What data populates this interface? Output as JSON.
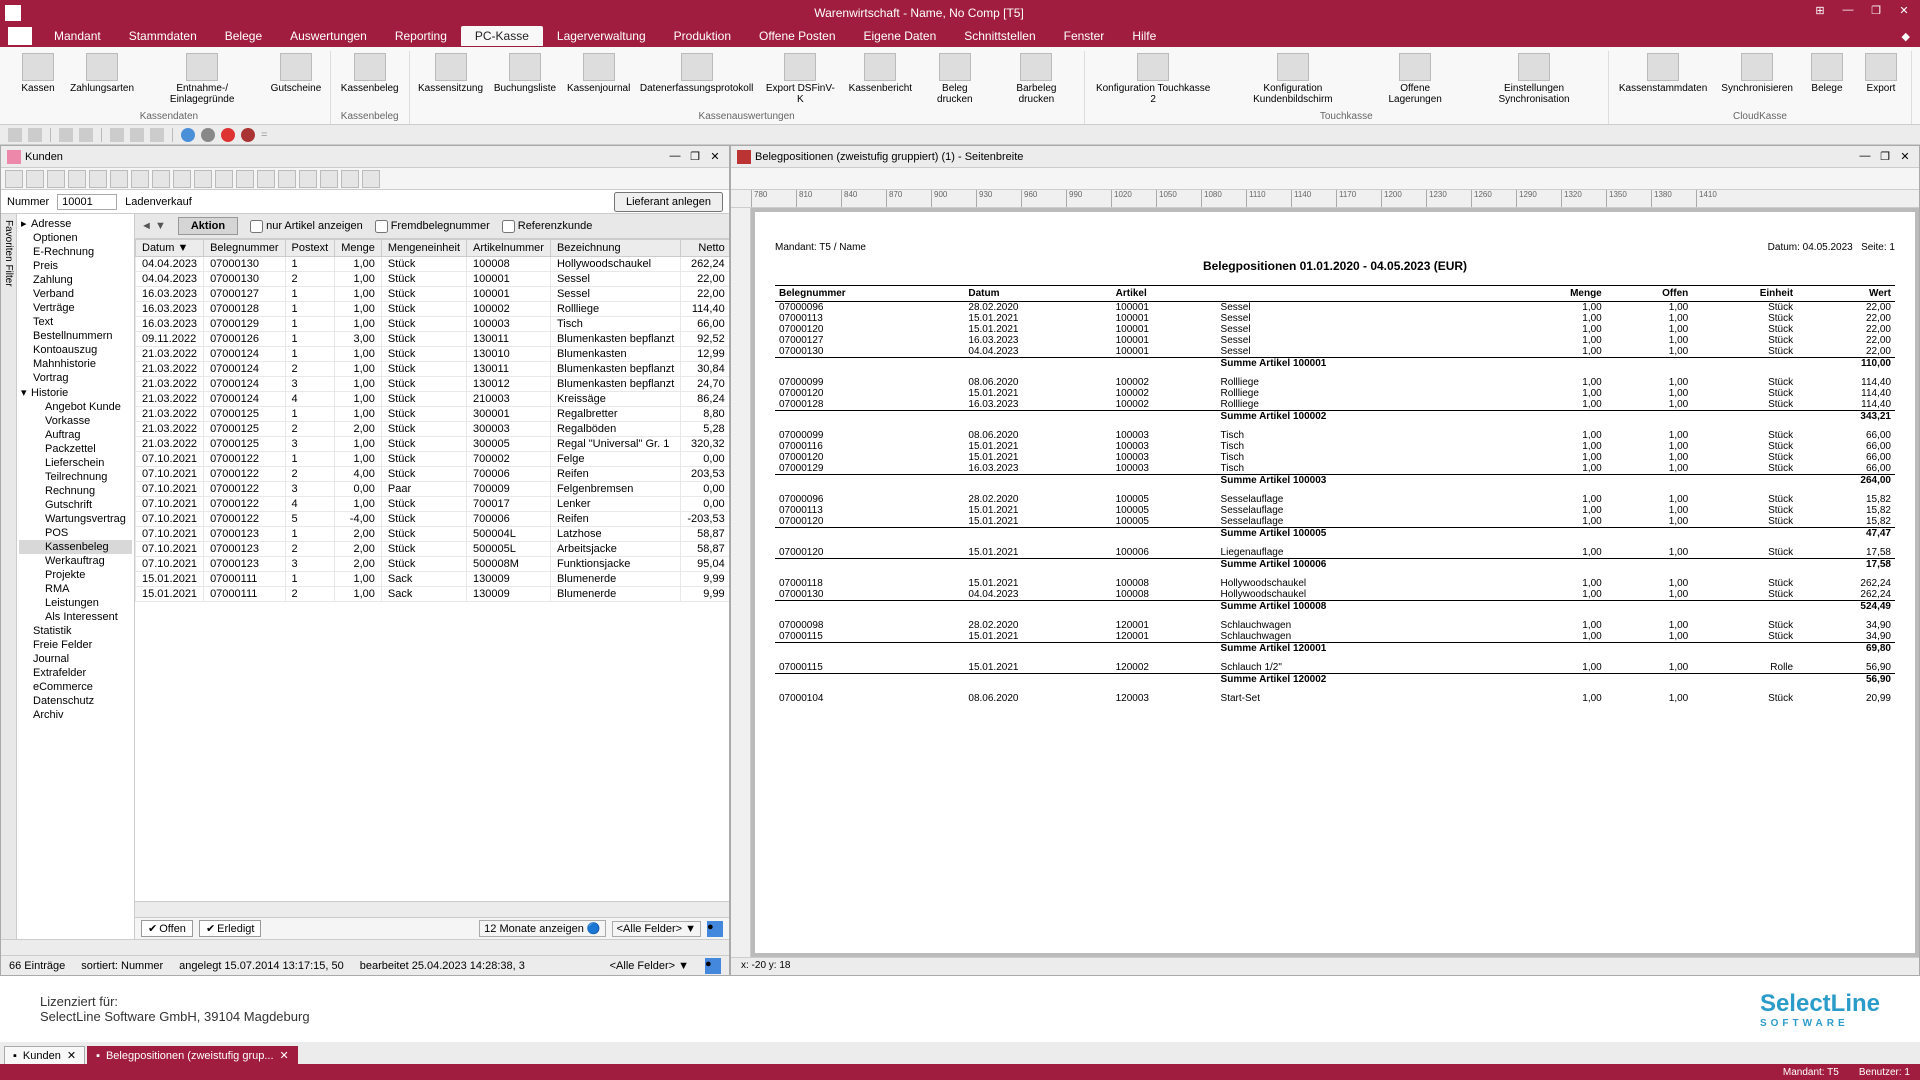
{
  "window": {
    "title": "Warenwirtschaft - Name, No Comp [T5]"
  },
  "menu": {
    "items": [
      "Mandant",
      "Stammdaten",
      "Belege",
      "Auswertungen",
      "Reporting",
      "PC-Kasse",
      "Lagerverwaltung",
      "Produktion",
      "Offene Posten",
      "Eigene Daten",
      "Schnittstellen",
      "Fenster",
      "Hilfe"
    ],
    "active": "PC-Kasse"
  },
  "ribbon": {
    "groups": [
      {
        "label": "Kassendaten",
        "items": [
          "Kassen",
          "Zahlungsarten",
          "Entnahme-/ Einlagegründe",
          "Gutscheine"
        ]
      },
      {
        "label": "Kassenbeleg",
        "items": [
          "Kassenbeleg"
        ]
      },
      {
        "label": "Kassenauswertungen",
        "items": [
          "Kassensitzung",
          "Buchungsliste",
          "Kassenjournal",
          "Datenerfassungsprotokoll",
          "Export DSFinV-K",
          "Kassenbericht",
          "Beleg drucken",
          "Barbeleg drucken"
        ]
      },
      {
        "label": "Touchkasse",
        "items": [
          "Konfiguration Touchkasse 2",
          "Konfiguration Kundenbildschirm",
          "Offene Lagerungen",
          "Einstellungen Synchronisation"
        ]
      },
      {
        "label": "CloudKasse",
        "items": [
          "Kassenstammdaten",
          "Synchronisieren",
          "Belege",
          "Export"
        ]
      }
    ]
  },
  "left_panel": {
    "title": "Kunden",
    "filter": {
      "label": "Nummer",
      "value": "10001",
      "name": "Ladenverkauf",
      "button": "Lieferant anlegen"
    },
    "tree": [
      {
        "label": "Adresse",
        "exp": "▸"
      },
      {
        "label": "Optionen"
      },
      {
        "label": "E-Rechnung"
      },
      {
        "label": "Preis"
      },
      {
        "label": "Zahlung"
      },
      {
        "label": "Verband"
      },
      {
        "label": "Verträge"
      },
      {
        "label": "Text"
      },
      {
        "label": "Bestellnummern"
      },
      {
        "label": "Kontoauszug"
      },
      {
        "label": "Mahnhistorie"
      },
      {
        "label": "Vortrag"
      },
      {
        "label": "Historie",
        "exp": "▾"
      },
      {
        "label": "Angebot Kunde",
        "indent": true
      },
      {
        "label": "Vorkasse",
        "indent": true
      },
      {
        "label": "Auftrag",
        "indent": true
      },
      {
        "label": "Packzettel",
        "indent": true
      },
      {
        "label": "Lieferschein",
        "indent": true
      },
      {
        "label": "Teilrechnung",
        "indent": true
      },
      {
        "label": "Rechnung",
        "indent": true
      },
      {
        "label": "Gutschrift",
        "indent": true
      },
      {
        "label": "Wartungsvertrag",
        "indent": true
      },
      {
        "label": "POS",
        "indent": true
      },
      {
        "label": "Kassenbeleg",
        "indent": true,
        "selected": true
      },
      {
        "label": "Werkauftrag",
        "indent": true
      },
      {
        "label": "Projekte",
        "indent": true
      },
      {
        "label": "RMA",
        "indent": true
      },
      {
        "label": "Leistungen",
        "indent": true
      },
      {
        "label": "Als Interessent",
        "indent": true
      },
      {
        "label": "Statistik"
      },
      {
        "label": "Freie Felder"
      },
      {
        "label": "Journal"
      },
      {
        "label": "Extrafelder"
      },
      {
        "label": "eCommerce"
      },
      {
        "label": "Datenschutz"
      },
      {
        "label": "Archiv"
      }
    ],
    "sidebar_tab": "Favoriten Filter",
    "grid": {
      "aktion_label": "Aktion",
      "filters": {
        "nurArtikel": "nur Artikel anzeigen",
        "fremdbeleg": "Fremdbelegnummer",
        "referenzkunde": "Referenzkunde"
      },
      "columns": [
        "Datum ▼",
        "Belegnummer",
        "Postext",
        "Menge",
        "Mengeneinheit",
        "Artikelnummer",
        "Bezeichnung",
        "Netto"
      ],
      "rows": [
        [
          "04.04.2023",
          "07000130",
          "1",
          "1,00",
          "Stück",
          "100008",
          "Hollywoodschaukel",
          "262,24"
        ],
        [
          "04.04.2023",
          "07000130",
          "2",
          "1,00",
          "Stück",
          "100001",
          "Sessel",
          "22,00"
        ],
        [
          "16.03.2023",
          "07000127",
          "1",
          "1,00",
          "Stück",
          "100001",
          "Sessel",
          "22,00"
        ],
        [
          "16.03.2023",
          "07000128",
          "1",
          "1,00",
          "Stück",
          "100002",
          "Rollliege",
          "114,40"
        ],
        [
          "16.03.2023",
          "07000129",
          "1",
          "1,00",
          "Stück",
          "100003",
          "Tisch",
          "66,00"
        ],
        [
          "09.11.2022",
          "07000126",
          "1",
          "3,00",
          "Stück",
          "130011",
          "Blumenkasten bepflanzt",
          "92,52"
        ],
        [
          "21.03.2022",
          "07000124",
          "1",
          "1,00",
          "Stück",
          "130010",
          "Blumenkasten",
          "12,99"
        ],
        [
          "21.03.2022",
          "07000124",
          "2",
          "1,00",
          "Stück",
          "130011",
          "Blumenkasten bepflanzt",
          "30,84"
        ],
        [
          "21.03.2022",
          "07000124",
          "3",
          "1,00",
          "Stück",
          "130012",
          "Blumenkasten bepflanzt",
          "24,70"
        ],
        [
          "21.03.2022",
          "07000124",
          "4",
          "1,00",
          "Stück",
          "210003",
          "Kreissäge",
          "86,24"
        ],
        [
          "21.03.2022",
          "07000125",
          "1",
          "1,00",
          "Stück",
          "300001",
          "Regalbretter",
          "8,80"
        ],
        [
          "21.03.2022",
          "07000125",
          "2",
          "2,00",
          "Stück",
          "300003",
          "Regalböden",
          "5,28"
        ],
        [
          "21.03.2022",
          "07000125",
          "3",
          "1,00",
          "Stück",
          "300005",
          "Regal \"Universal\" Gr. 1",
          "320,32"
        ],
        [
          "07.10.2021",
          "07000122",
          "1",
          "1,00",
          "Stück",
          "700002",
          "Felge",
          "0,00"
        ],
        [
          "07.10.2021",
          "07000122",
          "2",
          "4,00",
          "Stück",
          "700006",
          "Reifen",
          "203,53"
        ],
        [
          "07.10.2021",
          "07000122",
          "3",
          "0,00",
          "Paar",
          "700009",
          "Felgenbremsen",
          "0,00"
        ],
        [
          "07.10.2021",
          "07000122",
          "4",
          "1,00",
          "Stück",
          "700017",
          "Lenker",
          "0,00"
        ],
        [
          "07.10.2021",
          "07000122",
          "5",
          "-4,00",
          "Stück",
          "700006",
          "Reifen",
          "-203,53"
        ],
        [
          "07.10.2021",
          "07000123",
          "1",
          "2,00",
          "Stück",
          "500004L",
          "Latzhose",
          "58,87"
        ],
        [
          "07.10.2021",
          "07000123",
          "2",
          "2,00",
          "Stück",
          "500005L",
          "Arbeitsjacke",
          "58,87"
        ],
        [
          "07.10.2021",
          "07000123",
          "3",
          "2,00",
          "Stück",
          "500008M",
          "Funktionsjacke",
          "95,04"
        ],
        [
          "15.01.2021",
          "07000111",
          "1",
          "1,00",
          "Sack",
          "130009",
          "Blumenerde",
          "9,99"
        ],
        [
          "15.01.2021",
          "07000111",
          "2",
          "1,00",
          "Sack",
          "130009",
          "Blumenerde",
          "9,99"
        ]
      ],
      "footer": {
        "offen": "Offen",
        "erledigt": "Erledigt",
        "monate": "12 Monate anzeigen",
        "felder": "<Alle Felder>"
      }
    },
    "status": {
      "count": "66 Einträge",
      "sort": "sortiert: Nummer",
      "angelegt": "angelegt 15.07.2014 13:17:15, 50",
      "bearbeitet": "bearbeitet 25.04.2023 14:28:38, 3",
      "felder": "<Alle Felder>"
    }
  },
  "right_panel": {
    "title": "Belegpositionen (zweistufig gruppiert) (1) - Seitenbreite",
    "ruler": [
      "780",
      "810",
      "840",
      "870",
      "900",
      "930",
      "960",
      "990",
      "1020",
      "1050",
      "1080",
      "1110",
      "1140",
      "1170",
      "1200",
      "1230",
      "1260",
      "1290",
      "1320",
      "1350",
      "1380",
      "1410"
    ],
    "report": {
      "mandant": "Mandant: T5 / Name",
      "datum": "Datum: 04.05.2023",
      "seite": "Seite: 1",
      "title": "Belegpositionen  01.01.2020 - 04.05.2023 (EUR)",
      "columns": [
        "Belegnummer",
        "Datum",
        "Artikel",
        "",
        "Menge",
        "Offen",
        "Einheit",
        "Wert"
      ],
      "groups": [
        {
          "rows": [
            [
              "07000096",
              "28.02.2020",
              "100001",
              "Sessel",
              "1,00",
              "1,00",
              "Stück",
              "22,00"
            ],
            [
              "07000113",
              "15.01.2021",
              "100001",
              "Sessel",
              "1,00",
              "1,00",
              "Stück",
              "22,00"
            ],
            [
              "07000120",
              "15.01.2021",
              "100001",
              "Sessel",
              "1,00",
              "1,00",
              "Stück",
              "22,00"
            ],
            [
              "07000127",
              "16.03.2023",
              "100001",
              "Sessel",
              "1,00",
              "1,00",
              "Stück",
              "22,00"
            ],
            [
              "07000130",
              "04.04.2023",
              "100001",
              "Sessel",
              "1,00",
              "1,00",
              "Stück",
              "22,00"
            ]
          ],
          "sum_label": "Summe Artikel 100001",
          "sum_value": "110,00"
        },
        {
          "rows": [
            [
              "07000099",
              "08.06.2020",
              "100002",
              "Rollliege",
              "1,00",
              "1,00",
              "Stück",
              "114,40"
            ],
            [
              "07000120",
              "15.01.2021",
              "100002",
              "Rollliege",
              "1,00",
              "1,00",
              "Stück",
              "114,40"
            ],
            [
              "07000128",
              "16.03.2023",
              "100002",
              "Rollliege",
              "1,00",
              "1,00",
              "Stück",
              "114,40"
            ]
          ],
          "sum_label": "Summe Artikel 100002",
          "sum_value": "343,21"
        },
        {
          "rows": [
            [
              "07000099",
              "08.06.2020",
              "100003",
              "Tisch",
              "1,00",
              "1,00",
              "Stück",
              "66,00"
            ],
            [
              "07000116",
              "15.01.2021",
              "100003",
              "Tisch",
              "1,00",
              "1,00",
              "Stück",
              "66,00"
            ],
            [
              "07000120",
              "15.01.2021",
              "100003",
              "Tisch",
              "1,00",
              "1,00",
              "Stück",
              "66,00"
            ],
            [
              "07000129",
              "16.03.2023",
              "100003",
              "Tisch",
              "1,00",
              "1,00",
              "Stück",
              "66,00"
            ]
          ],
          "sum_label": "Summe Artikel 100003",
          "sum_value": "264,00"
        },
        {
          "rows": [
            [
              "07000096",
              "28.02.2020",
              "100005",
              "Sesselauflage",
              "1,00",
              "1,00",
              "Stück",
              "15,82"
            ],
            [
              "07000113",
              "15.01.2021",
              "100005",
              "Sesselauflage",
              "1,00",
              "1,00",
              "Stück",
              "15,82"
            ],
            [
              "07000120",
              "15.01.2021",
              "100005",
              "Sesselauflage",
              "1,00",
              "1,00",
              "Stück",
              "15,82"
            ]
          ],
          "sum_label": "Summe Artikel 100005",
          "sum_value": "47,47"
        },
        {
          "rows": [
            [
              "07000120",
              "15.01.2021",
              "100006",
              "Liegenauflage",
              "1,00",
              "1,00",
              "Stück",
              "17,58"
            ]
          ],
          "sum_label": "Summe Artikel 100006",
          "sum_value": "17,58"
        },
        {
          "rows": [
            [
              "07000118",
              "15.01.2021",
              "100008",
              "Hollywoodschaukel",
              "1,00",
              "1,00",
              "Stück",
              "262,24"
            ],
            [
              "07000130",
              "04.04.2023",
              "100008",
              "Hollywoodschaukel",
              "1,00",
              "1,00",
              "Stück",
              "262,24"
            ]
          ],
          "sum_label": "Summe Artikel 100008",
          "sum_value": "524,49"
        },
        {
          "rows": [
            [
              "07000098",
              "28.02.2020",
              "120001",
              "Schlauchwagen",
              "1,00",
              "1,00",
              "Stück",
              "34,90"
            ],
            [
              "07000115",
              "15.01.2021",
              "120001",
              "Schlauchwagen",
              "1,00",
              "1,00",
              "Stück",
              "34,90"
            ]
          ],
          "sum_label": "Summe Artikel 120001",
          "sum_value": "69,80"
        },
        {
          "rows": [
            [
              "07000115",
              "15.01.2021",
              "120002",
              "Schlauch 1/2\"",
              "1,00",
              "1,00",
              "Rolle",
              "56,90"
            ]
          ],
          "sum_label": "Summe Artikel 120002",
          "sum_value": "56,90"
        },
        {
          "rows": [
            [
              "07000104",
              "08.06.2020",
              "120003",
              "Start-Set",
              "1,00",
              "1,00",
              "Stück",
              "20,99"
            ]
          ]
        }
      ]
    },
    "status": "x: -20    y: 18"
  },
  "license": {
    "label": "Lizenziert für:",
    "text": "SelectLine Software GmbH, 39104 Magdeburg",
    "logo": "SelectLine",
    "logo_sub": "SOFTWARE"
  },
  "tabs": [
    {
      "icon": "user",
      "label": "Kunden",
      "active": false
    },
    {
      "icon": "doc",
      "label": "Belegpositionen (zweistufig grup...",
      "active": true
    }
  ],
  "global_status": {
    "mandant": "Mandant: T5",
    "benutzer": "Benutzer: 1"
  }
}
